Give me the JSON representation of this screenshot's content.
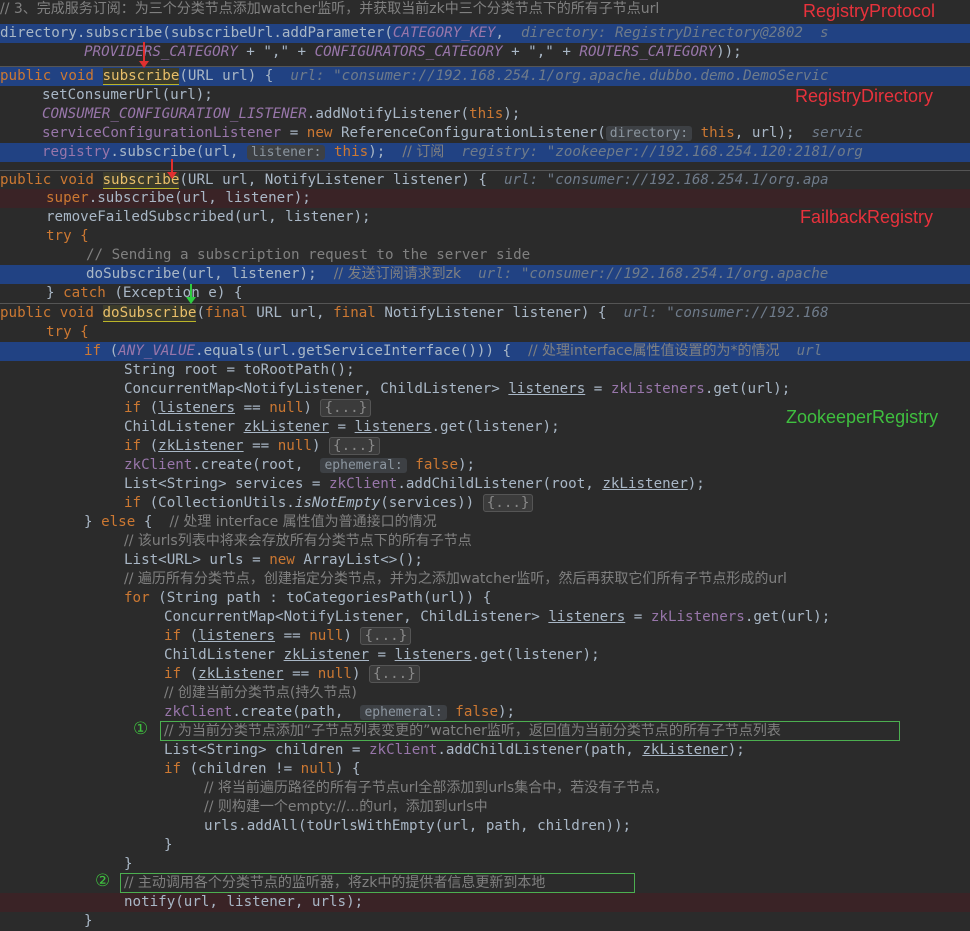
{
  "labels": {
    "registry_protocol": "RegistryProtocol",
    "registry_directory": "RegistryDirectory",
    "failback_registry": "FailbackRegistry",
    "zookeeper_registry": "ZookeeperRegistry"
  },
  "markers": {
    "one": "①",
    "two": "②"
  },
  "code": {
    "l0_comment": "// 3、完成服务订阅：为三个分类节点添加watcher监听，并获取当前zk中三个分类节点下的所有子节点url",
    "l1_a": "directory.subscribe(subscribeUrl.addParameter(",
    "l1_const": "CATEGORY_KEY",
    "l1_b": ",  ",
    "l1_hint": "directory: RegistryDirectory@2802  s",
    "l2_p1": "PROVIDERS_CATEGORY",
    "l2_p2": " + \",\" + ",
    "l2_p3": "CONFIGURATORS_CATEGORY",
    "l2_p4": " + \",\" + ",
    "l2_p5": "ROUTERS_CATEGORY",
    "l2_p6": "));",
    "l3_kw": "public void ",
    "l3_fn": "subscribe",
    "l3_rest": "(URL url) {  ",
    "l3_hint": "url: \"consumer://192.168.254.1/org.apache.dubbo.demo.DemoServic",
    "l4": "setConsumerUrl(url);",
    "l5_a": "CONSUMER_CONFIGURATION_LISTENER",
    "l5_b": ".addNotifyListener(",
    "l5_this": "this",
    "l5_c": ");",
    "l6_a": "serviceConfigurationListener",
    "l6_b": " = ",
    "l6_new": "new ",
    "l6_c": "ReferenceConfigurationListener(",
    "l6_chip": "directory:",
    "l6_this": " this",
    "l6_d": ", url);  ",
    "l6_tail": "servic",
    "l7_a": "registry",
    "l7_b": ".subscribe(url, ",
    "l7_chip": "listener:",
    "l7_this": " this",
    "l7_c": ");  ",
    "l7_cmt": "// 订阅",
    "l7_hint": "  registry: \"zookeeper://192.168.254.120:2181/org",
    "l8_kw": "public void ",
    "l8_fn": "subscribe",
    "l8_rest": "(URL url, NotifyListener listener) {  ",
    "l8_hint": "url: \"consumer://192.168.254.1/org.apa",
    "l9_kw": "super",
    "l9_rest": ".subscribe(url, listener);",
    "l10": "removeFailedSubscribed(url, listener);",
    "l11": "try {",
    "l12": "// Sending a subscription request to the server side",
    "l13_a": "doSubscribe(url, listener);  ",
    "l13_cmt": "// 发送订阅请求到zk",
    "l13_hint": "  url: \"consumer://192.168.254.1/org.apache",
    "l14_a": "} ",
    "l14_kw": "catch ",
    "l14_b": "(Exception e) {",
    "l15_kw1": "public void ",
    "l15_fn": "doSubscribe",
    "l15_b": "(",
    "l15_kw2": "final ",
    "l15_c": "URL url, ",
    "l15_kw3": "final ",
    "l15_d": "NotifyListener listener) {  ",
    "l15_hint": "url: \"consumer://192.168",
    "l16": "try {",
    "l17_kw": "if ",
    "l17_a": "(",
    "l17_const": "ANY_VALUE",
    "l17_b": ".equals(url.getServiceInterface())) {  ",
    "l17_cmt": "// 处理interface属性值设置的为*的情况",
    "l17_hint": "  url",
    "l18_a": "String root = toRootPath();",
    "l19_a": "ConcurrentMap<NotifyListener, ChildListener> ",
    "l19_v": "listeners",
    "l19_b": " = ",
    "l19_f": "zkListeners",
    "l19_c": ".get(url);",
    "l20_kw": "if ",
    "l20_a": "(",
    "l20_v": "listeners",
    "l20_b": " == ",
    "l20_null": "null",
    "l20_c": ") ",
    "fold": "{...}",
    "l21_a": "ChildListener ",
    "l21_v": "zkListener",
    "l21_b": " = ",
    "l21_v2": "listeners",
    "l21_c": ".get(listener);",
    "l22_kw": "if ",
    "l22_a": "(",
    "l22_v": "zkListener",
    "l22_b": " == ",
    "l22_null": "null",
    "l22_c": ") ",
    "l23_f": "zkClient",
    "l23_a": ".create(root,  ",
    "l23_chip": "ephemeral:",
    "l23_false": " false",
    "l23_b": ");",
    "l24_a": "List<String> services = ",
    "l24_f": "zkClient",
    "l24_b": ".addChildListener(root, ",
    "l24_v": "zkListener",
    "l24_c": ");",
    "l25_kw": "if ",
    "l25_a": "(CollectionUtils.",
    "l25_m": "isNotEmpty",
    "l25_b": "(services)) ",
    "l26_a": "} ",
    "l26_kw": "else ",
    "l26_b": "{  ",
    "l26_cmt": "// 处理 interface 属性值为普通接口的情况",
    "l27_cmt": "// 该urls列表中将来会存放所有分类节点下的所有子节点",
    "l28_a": "List<URL> urls = ",
    "l28_new": "new ",
    "l28_b": "ArrayList<>();",
    "l29_cmt": "// 遍历所有分类节点，创建指定分类节点，并为之添加watcher监听，然后再获取它们所有子节点形成的url",
    "l30_kw": "for ",
    "l30_a": "(String path : toCategoriesPath(url)) {",
    "l31_a": "ConcurrentMap<NotifyListener, ChildListener> ",
    "l31_v": "listeners",
    "l31_b": " = ",
    "l31_f": "zkListeners",
    "l31_c": ".get(url);",
    "l32_kw": "if ",
    "l32_a": "(",
    "l32_v": "listeners",
    "l32_b": " == ",
    "l32_null": "null",
    "l32_c": ") ",
    "l33_a": "ChildListener ",
    "l33_v": "zkListener",
    "l33_b": " = ",
    "l33_v2": "listeners",
    "l33_c": ".get(listener);",
    "l34_kw": "if ",
    "l34_a": "(",
    "l34_v": "zkListener",
    "l34_b": " == ",
    "l34_null": "null",
    "l34_c": ") ",
    "l35_cmt": "// 创建当前分类节点(持久节点)",
    "l36_f": "zkClient",
    "l36_a": ".create(path,  ",
    "l36_chip": "ephemeral:",
    "l36_false": " false",
    "l36_b": ");",
    "l37_cmt": "// 为当前分类节点添加“子节点列表变更的”watcher监听，返回值为当前分类节点的所有子节点列表",
    "l38_a": "List<String> children = ",
    "l38_f": "zkClient",
    "l38_b": ".addChildListener(path, ",
    "l38_v": "zkListener",
    "l38_c": ");",
    "l39_kw": "if ",
    "l39_a": "(children != ",
    "l39_null": "null",
    "l39_b": ") {",
    "l40_cmt": "// 将当前遍历路径的所有子节点url全部添加到urls集合中，若没有子节点，",
    "l41_cmt": "// 则构建一个empty://...的url，添加到urls中",
    "l42": "urls.addAll(toUrlsWithEmpty(url, path, children));",
    "l43": "}",
    "l44": "}",
    "l45_cmt": "// 主动调用各个分类节点的监听器，将zk中的提供者信息更新到本地",
    "l46": "notify(url, listener, urls);",
    "l47": "}"
  }
}
